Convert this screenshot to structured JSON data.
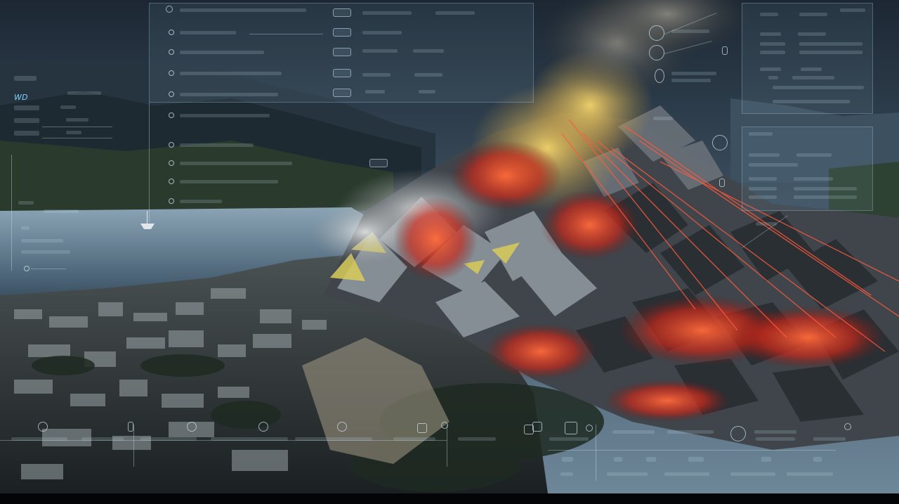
{
  "colors": {
    "sky": "#3a4d5e",
    "water": "#7d97ab",
    "lava": "#e0311f",
    "hud_text": "#cfe4f0",
    "hud_accent": "#7fd0ff",
    "laser": "#ff5a3c"
  },
  "left_readout": {
    "rows": [
      {
        "value": "WD",
        "label": ""
      },
      {
        "value": "",
        "label": ""
      },
      {
        "value": "",
        "label": ""
      },
      {
        "value": "",
        "label": ""
      }
    ]
  },
  "icons": {
    "bottom": [
      "camera-icon",
      "shield-icon",
      "target-icon",
      "wave-icon",
      "pin-icon",
      "alert-icon",
      "sensor-icon",
      "signal-icon",
      "gauge-icon",
      "drone-icon",
      "radar-icon",
      "lock-icon"
    ]
  }
}
